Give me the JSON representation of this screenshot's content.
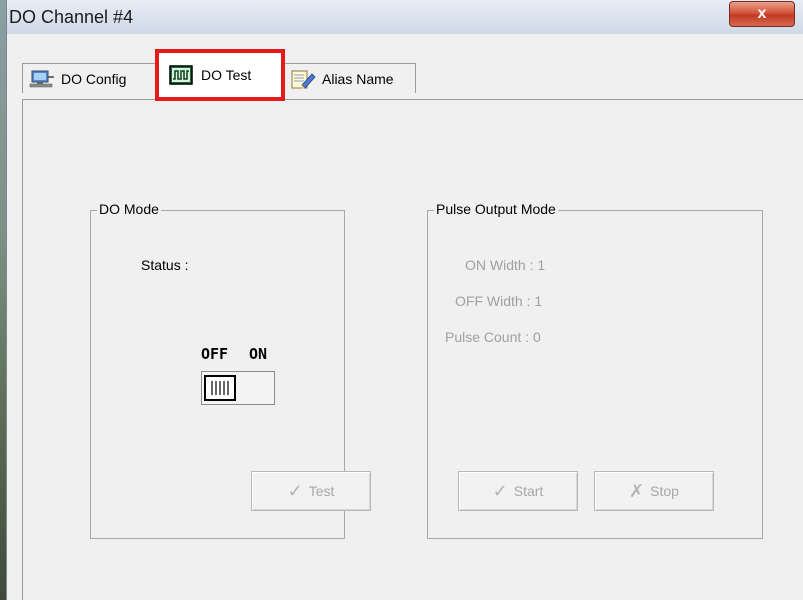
{
  "window": {
    "title": "DO Channel #4",
    "close_glyph": "x"
  },
  "tabs": [
    {
      "label": "DO Config",
      "icon": "monitor-network-icon"
    },
    {
      "label": "DO Test",
      "icon": "waveform-icon",
      "selected": true
    },
    {
      "label": "Alias Name",
      "icon": "notepad-pencil-icon"
    }
  ],
  "do_mode": {
    "group_label": "DO Mode",
    "status_label": "Status :",
    "switch_off_label": "OFF",
    "switch_on_label": "ON",
    "switch_state": "off",
    "test_button_label": "Test",
    "test_button_icon": "checkmark-icon"
  },
  "pulse_output_mode": {
    "group_label": "Pulse Output Mode",
    "on_width": "ON Width : 1",
    "off_width": "OFF Width : 1",
    "pulse_count": "Pulse Count : 0",
    "start_button_label": "Start",
    "start_button_icon": "checkmark-icon",
    "stop_button_label": "Stop",
    "stop_button_icon": "x-mark-icon"
  },
  "colors": {
    "highlight_border": "#e31b1b",
    "disabled_text": "#a0a0a0"
  }
}
